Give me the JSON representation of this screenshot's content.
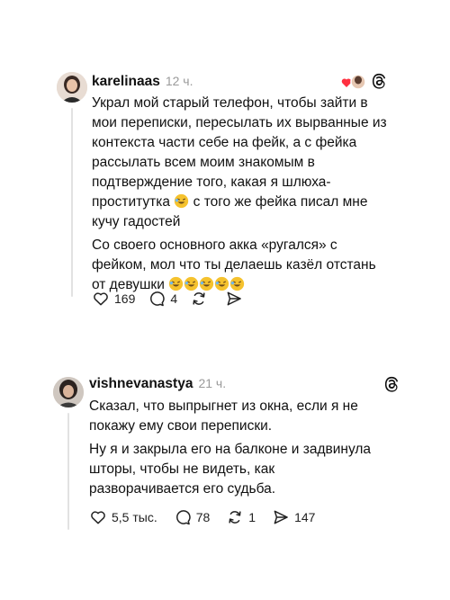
{
  "posts": [
    {
      "username": "karelinaas",
      "time": "12 ч.",
      "paragraph1_parts": [
        "Украл мой старый телефон, чтобы зайти в мои переписки, пересылать их вырванные из контекста части себе на фейк, а с фейка рассылать всем моим знакомым в подтверждение того, какая я шлюха-проститутка",
        " с того же фейка писал мне кучу гадостей"
      ],
      "paragraph2": "Со своего основного акка «ругался» с фейком, мол что ты делаешь казёл отстань от девушки",
      "emoji_name": "rolling-on-floor-laughing",
      "trailing_emoji_count": 5,
      "likes": "169",
      "comments": "4",
      "reposts": "",
      "shares": ""
    },
    {
      "username": "vishnevanastya",
      "time": "21 ч.",
      "paragraph1": "Сказал, что выпрыгнет из окна, если я не покажу ему свои переписки.",
      "paragraph2": "Ну я и закрыла его на балконе и задвинула шторы, чтобы не видеть, как разворачивается его судьба.",
      "likes": "5,5 тыс.",
      "comments": "78",
      "reposts": "1",
      "shares": "147"
    }
  ],
  "icons": {
    "like": "heart-outline-icon",
    "comment": "speech-bubble-icon",
    "repost": "repost-arrows-icon",
    "share": "send-arrow-icon",
    "brand": "threads-logo-icon"
  },
  "colors": {
    "text": "#111111",
    "muted": "#9a9a9a",
    "heart_red": "#ff3040",
    "emoji_yellow": "#f5c22e"
  }
}
